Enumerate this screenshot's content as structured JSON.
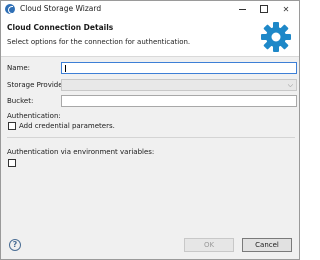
{
  "window": {
    "title": "Cloud Storage Wizard",
    "icon": "app-logo-icon"
  },
  "banner": {
    "title": "Cloud Connection Details",
    "subtitle": "Select options for the connection for authentication.",
    "icon": "gear-icon",
    "accent": "#1e88c8"
  },
  "form": {
    "name": {
      "label": "Name:",
      "value": "",
      "placeholder": ""
    },
    "storage_provider": {
      "label": "Storage Provider:",
      "value": ""
    },
    "bucket": {
      "label": "Bucket:",
      "value": ""
    }
  },
  "authentication": {
    "label": "Authentication:",
    "checkbox_label": "Add credential parameters.",
    "checked": false
  },
  "env_auth": {
    "label": "Authentication via environment variables:",
    "checked": false
  },
  "footer": {
    "help_label": "?",
    "ok_label": "OK",
    "ok_enabled": false,
    "cancel_label": "Cancel"
  }
}
